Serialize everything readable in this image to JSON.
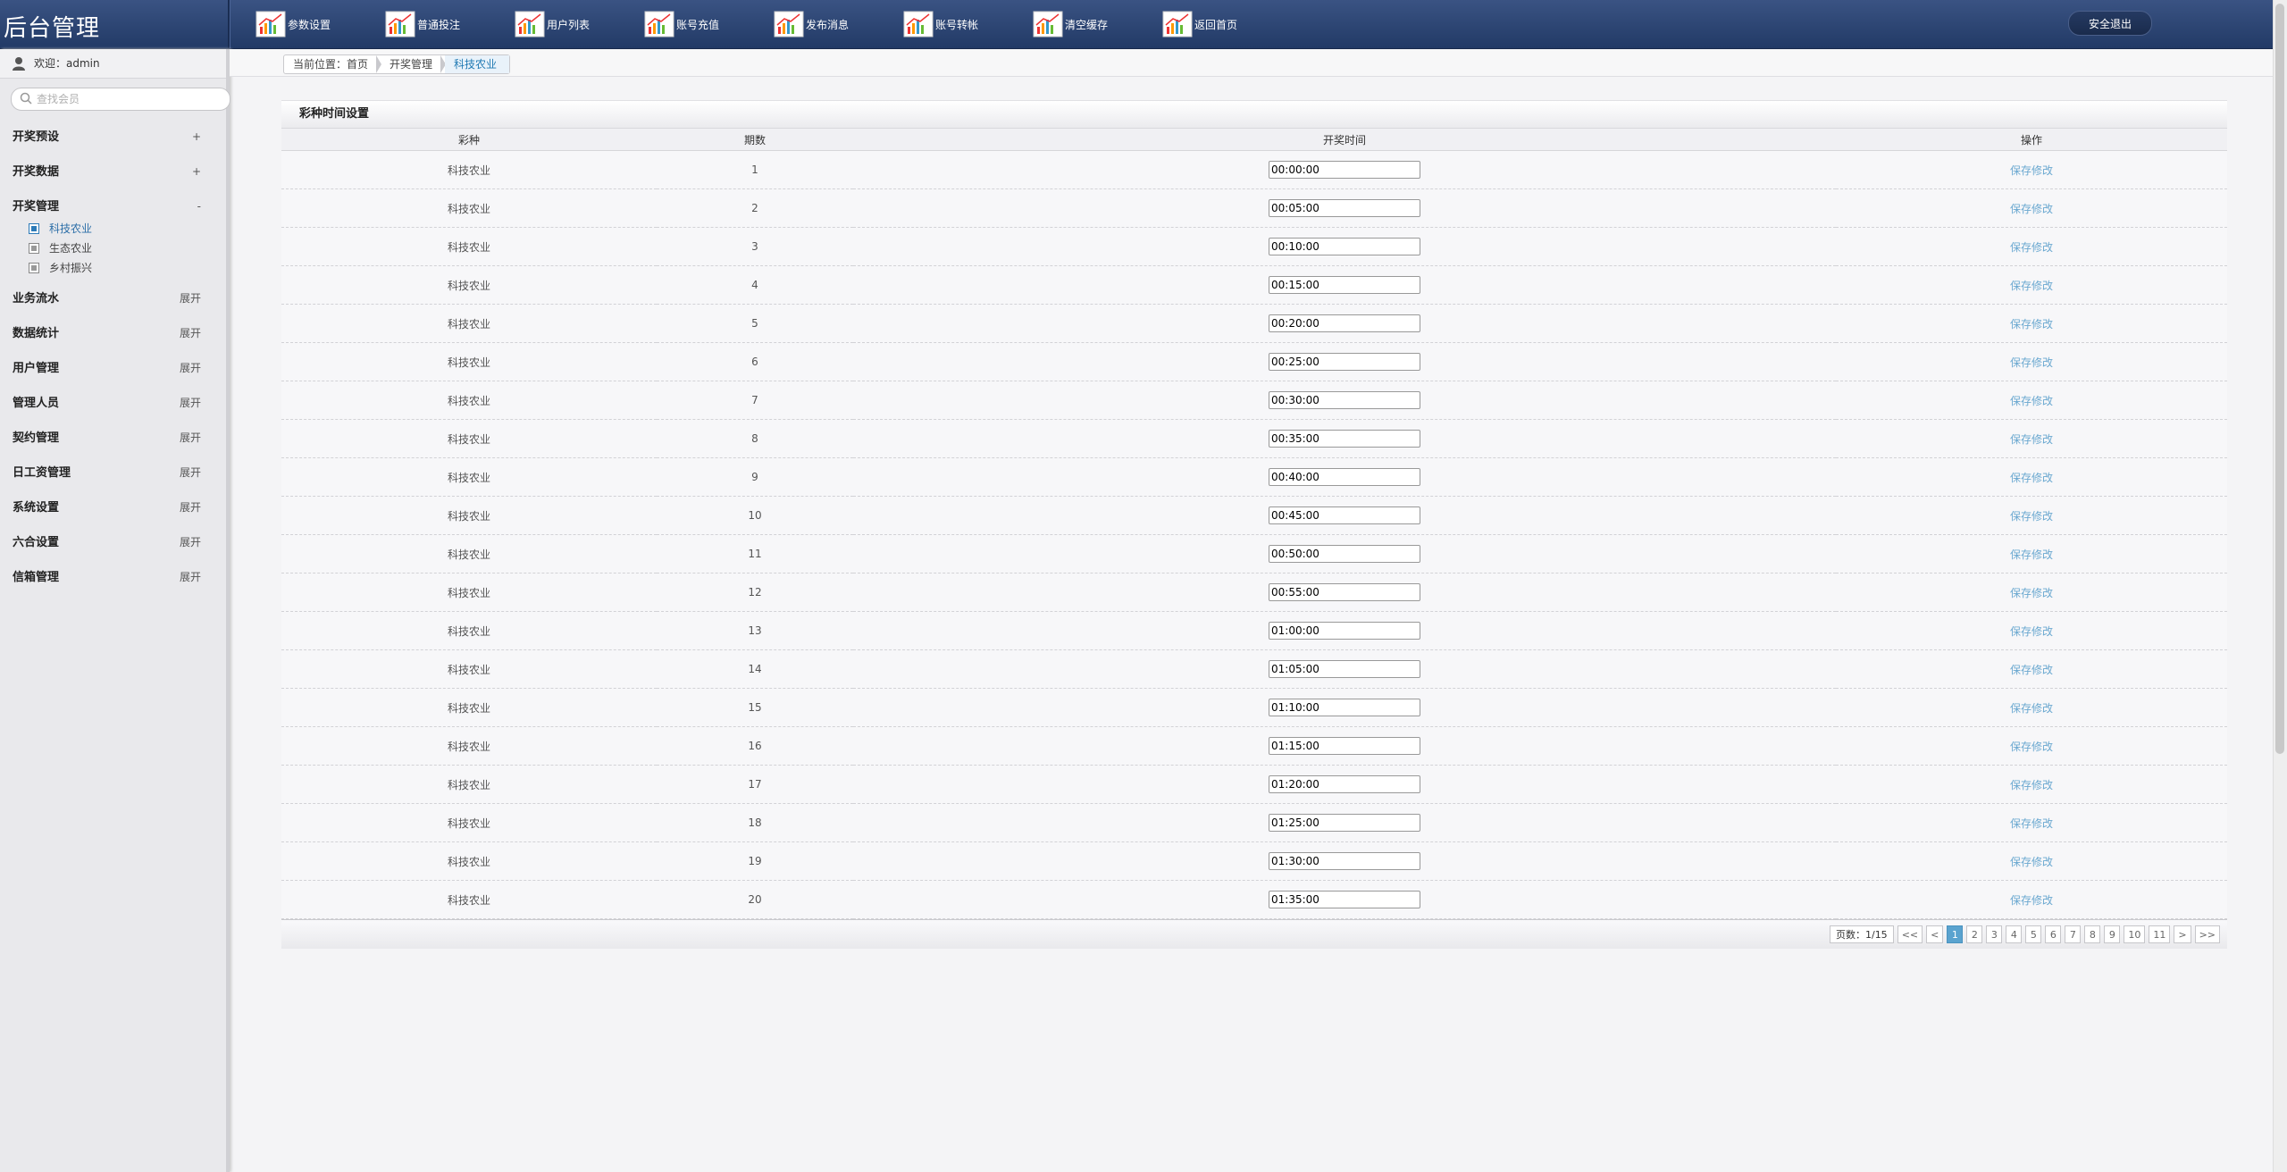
{
  "app": {
    "title": "后台管理"
  },
  "topnav": [
    {
      "label": "参数设置"
    },
    {
      "label": "普通投注"
    },
    {
      "label": "用户列表"
    },
    {
      "label": "账号充值"
    },
    {
      "label": "发布消息"
    },
    {
      "label": "账号转帐"
    },
    {
      "label": "清空缓存"
    },
    {
      "label": "返回首页"
    }
  ],
  "logout_label": "安全退出",
  "sidebar": {
    "welcome": "欢迎：admin",
    "search_placeholder": "查找会员",
    "groups": [
      {
        "label": "开奖预设",
        "toggle": "+"
      },
      {
        "label": "开奖数据",
        "toggle": "+"
      },
      {
        "label": "开奖管理",
        "toggle": "-"
      },
      {
        "label": "业务流水",
        "toggle": "展开"
      },
      {
        "label": "数据统计",
        "toggle": "展开"
      },
      {
        "label": "用户管理",
        "toggle": "展开"
      },
      {
        "label": "管理人员",
        "toggle": "展开"
      },
      {
        "label": "契约管理",
        "toggle": "展开"
      },
      {
        "label": "日工资管理",
        "toggle": "展开"
      },
      {
        "label": "系统设置",
        "toggle": "展开"
      },
      {
        "label": "六合设置",
        "toggle": "展开"
      },
      {
        "label": "信箱管理",
        "toggle": "展开"
      }
    ],
    "subitems": [
      {
        "label": "科技农业"
      },
      {
        "label": "生态农业"
      },
      {
        "label": "乡村振兴"
      }
    ]
  },
  "breadcrumb": [
    "当前位置：首页",
    "开奖管理",
    "科技农业"
  ],
  "panel": {
    "title": "彩种时间设置",
    "headers": {
      "type": "彩种",
      "period": "期数",
      "time": "开奖时间",
      "op": "操作"
    },
    "save_label": "保存修改",
    "rows": [
      {
        "type": "科技农业",
        "period": "1",
        "time": "00:00:00"
      },
      {
        "type": "科技农业",
        "period": "2",
        "time": "00:05:00"
      },
      {
        "type": "科技农业",
        "period": "3",
        "time": "00:10:00"
      },
      {
        "type": "科技农业",
        "period": "4",
        "time": "00:15:00"
      },
      {
        "type": "科技农业",
        "period": "5",
        "time": "00:20:00"
      },
      {
        "type": "科技农业",
        "period": "6",
        "time": "00:25:00"
      },
      {
        "type": "科技农业",
        "period": "7",
        "time": "00:30:00"
      },
      {
        "type": "科技农业",
        "period": "8",
        "time": "00:35:00"
      },
      {
        "type": "科技农业",
        "period": "9",
        "time": "00:40:00"
      },
      {
        "type": "科技农业",
        "period": "10",
        "time": "00:45:00"
      },
      {
        "type": "科技农业",
        "period": "11",
        "time": "00:50:00"
      },
      {
        "type": "科技农业",
        "period": "12",
        "time": "00:55:00"
      },
      {
        "type": "科技农业",
        "period": "13",
        "time": "01:00:00"
      },
      {
        "type": "科技农业",
        "period": "14",
        "time": "01:05:00"
      },
      {
        "type": "科技农业",
        "period": "15",
        "time": "01:10:00"
      },
      {
        "type": "科技农业",
        "period": "16",
        "time": "01:15:00"
      },
      {
        "type": "科技农业",
        "period": "17",
        "time": "01:20:00"
      },
      {
        "type": "科技农业",
        "period": "18",
        "time": "01:25:00"
      },
      {
        "type": "科技农业",
        "period": "19",
        "time": "01:30:00"
      },
      {
        "type": "科技农业",
        "period": "20",
        "time": "01:35:00"
      }
    ]
  },
  "pager": {
    "info": "页数：1/15",
    "first": "<<",
    "prev": "<",
    "pages": [
      "1",
      "2",
      "3",
      "4",
      "5",
      "6",
      "7",
      "8",
      "9",
      "10",
      "11"
    ],
    "current": "1",
    "next": ">",
    "last": ">>"
  },
  "colors": {
    "topbar": "#2c4575",
    "accent": "#5aa3cf",
    "link": "#6aa8d0"
  }
}
